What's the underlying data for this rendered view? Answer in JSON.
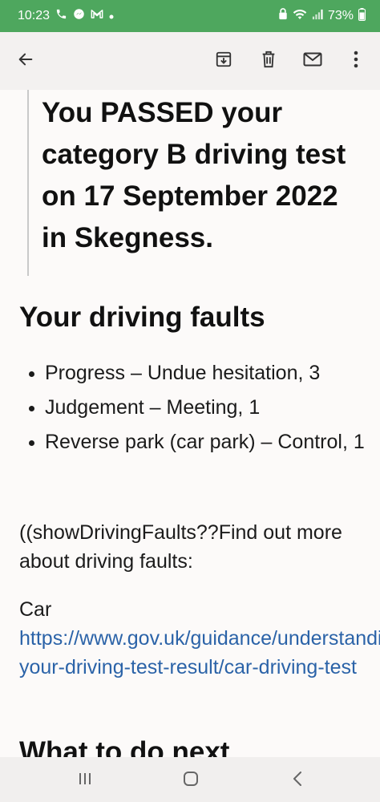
{
  "status_bar": {
    "time": "10:23",
    "battery": "73%",
    "left_icons": [
      "phone-icon",
      "messenger-icon",
      "gmail-icon",
      "dot-icon"
    ],
    "right_icons": [
      "lock-icon",
      "wifi-icon",
      "signal-icon",
      "battery-icon"
    ]
  },
  "toolbar": {
    "icons": [
      "back-arrow-icon",
      "archive-icon",
      "delete-icon",
      "mail-icon",
      "more-icon"
    ]
  },
  "email": {
    "result_text": "You PASSED your category B driving test on 17 September 2022 in Skegness.",
    "faults_heading": "Your driving faults",
    "faults": [
      "Progress – Undue hesitation, 3",
      "Judgement – Meeting, 1",
      "Reverse park (car park) – Control, 1"
    ],
    "template_text": "((showDrivingFaults??Find out more about driving faults:",
    "car_label": "Car",
    "car_link": "https://www.gov.uk/guidance/understanding-your-driving-test-result/car-driving-test",
    "next_heading": "What to do next"
  },
  "nav_bar": {
    "icons": [
      "recents-icon",
      "home-icon",
      "back-icon"
    ]
  }
}
